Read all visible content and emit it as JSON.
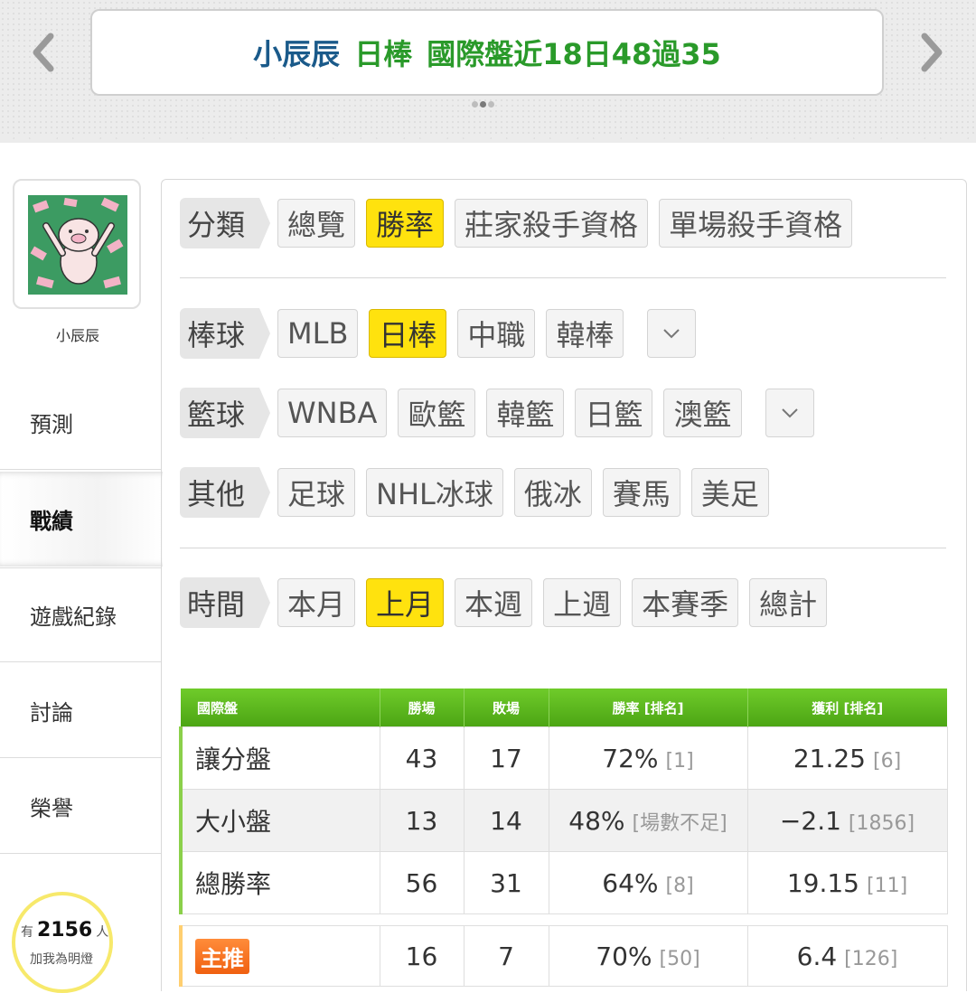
{
  "header": {
    "name": "小辰辰",
    "league": "日棒",
    "record": "國際盤近18日48過35"
  },
  "sidebar": {
    "username": "小辰辰",
    "items": [
      {
        "label": "預測"
      },
      {
        "label": "戰績"
      },
      {
        "label": "遊戲紀錄"
      },
      {
        "label": "討論"
      },
      {
        "label": "榮譽"
      }
    ],
    "fans": {
      "prefix": "有",
      "count": "2156",
      "suffix": "人",
      "sub": "加我為明燈"
    }
  },
  "filters": {
    "category": {
      "label": "分類",
      "options": [
        "總覽",
        "勝率",
        "莊家殺手資格",
        "單場殺手資格"
      ],
      "selected": "勝率"
    },
    "baseball": {
      "label": "棒球",
      "options": [
        "MLB",
        "日棒",
        "中職",
        "韓棒"
      ],
      "selected": "日棒"
    },
    "basketball": {
      "label": "籃球",
      "options": [
        "WNBA",
        "歐籃",
        "韓籃",
        "日籃",
        "澳籃"
      ]
    },
    "other": {
      "label": "其他",
      "options": [
        "足球",
        "NHL冰球",
        "俄冰",
        "賽馬",
        "美足"
      ]
    },
    "time": {
      "label": "時間",
      "options": [
        "本月",
        "上月",
        "本週",
        "上週",
        "本賽季",
        "總計"
      ],
      "selected": "上月"
    }
  },
  "table": {
    "headers": [
      "國際盤",
      "勝場",
      "敗場",
      "勝率 [排名]",
      "獲利 [排名]"
    ],
    "rows": [
      {
        "name": "讓分盤",
        "win": "43",
        "loss": "17",
        "rate": "72%",
        "rate_rank": "[1]",
        "profit": "21.25",
        "profit_rank": "[6]"
      },
      {
        "name": "大小盤",
        "win": "13",
        "loss": "14",
        "rate": "48%",
        "rate_rank": "[場數不足]",
        "profit": "−2.1",
        "profit_rank": "[1856]"
      },
      {
        "name": "總勝率",
        "win": "56",
        "loss": "31",
        "rate": "64%",
        "rate_rank": "[8]",
        "profit": "19.15",
        "profit_rank": "[11]"
      }
    ],
    "main": {
      "name": "主推",
      "win": "16",
      "loss": "7",
      "rate": "70%",
      "rate_rank": "[50]",
      "profit": "6.4",
      "profit_rank": "[126]"
    }
  }
}
